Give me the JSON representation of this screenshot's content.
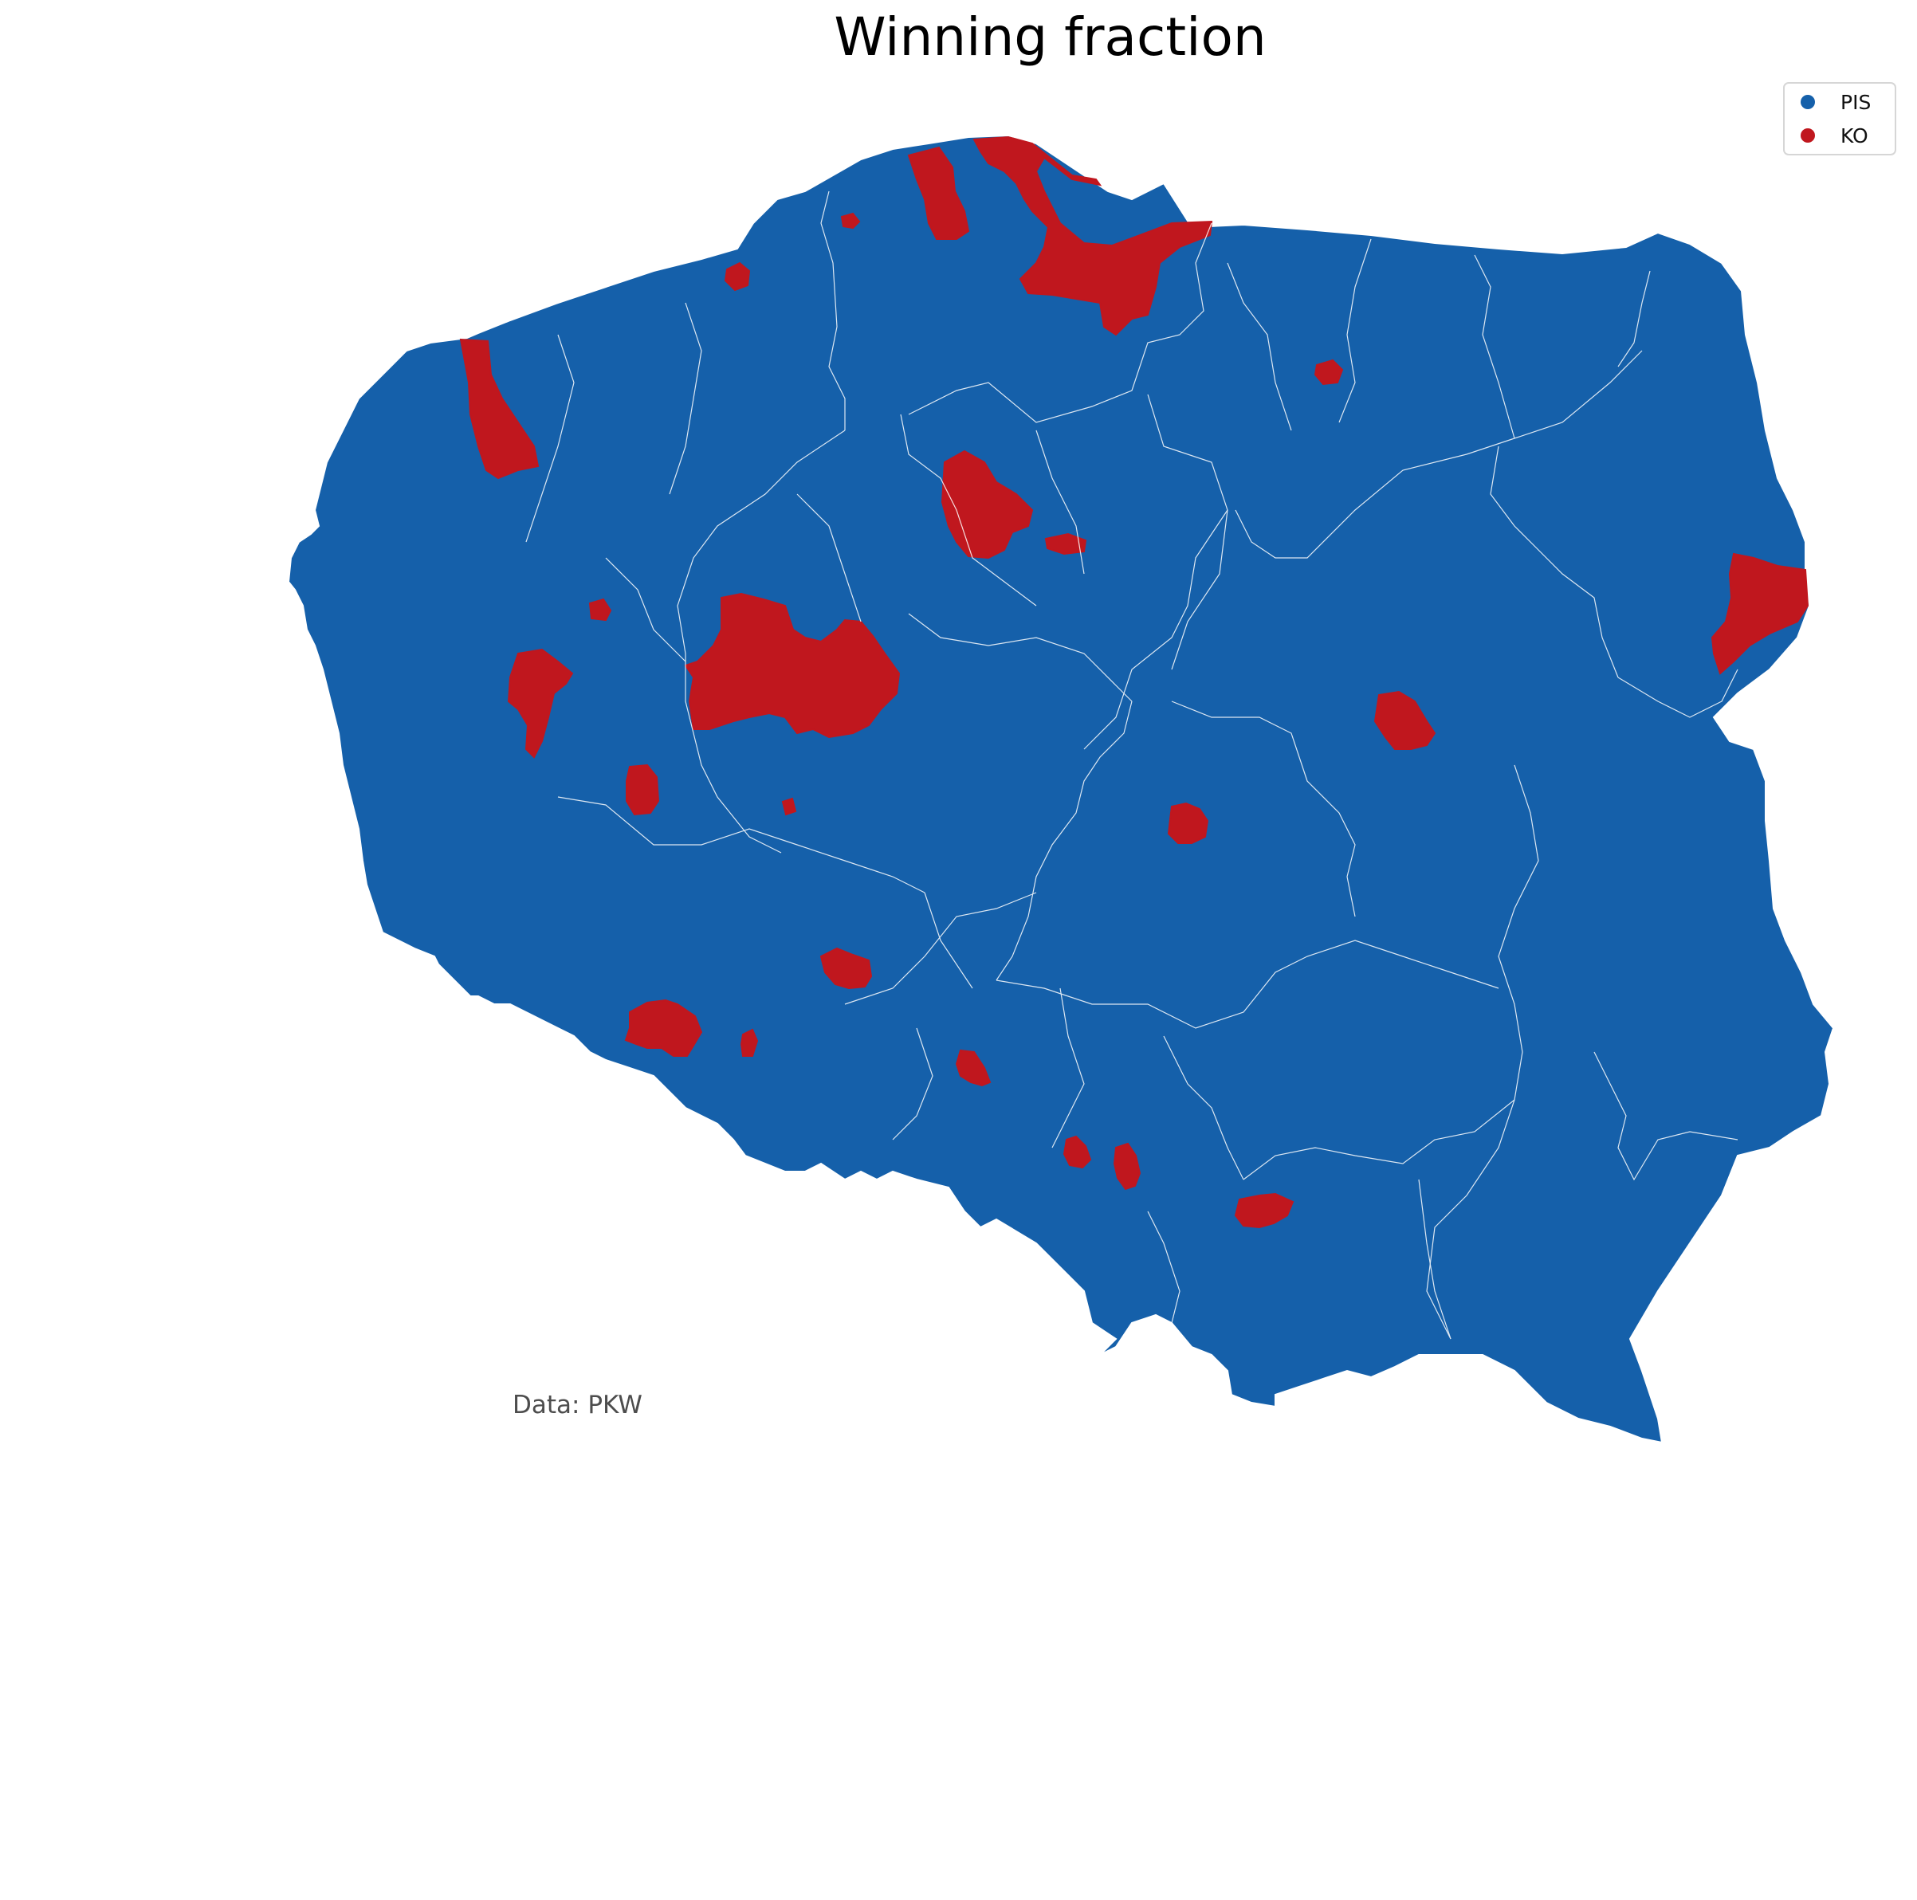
{
  "title": "Winning fraction",
  "source_note": "Data: PKW",
  "colors": {
    "PIS": "#1560aa",
    "KO": "#c0171e",
    "border": "#ffffff"
  },
  "legend": {
    "placement": "top-right",
    "items": [
      {
        "label": "PIS",
        "color": "#1560aa"
      },
      {
        "label": "KO",
        "color": "#c0171e"
      }
    ]
  }
}
